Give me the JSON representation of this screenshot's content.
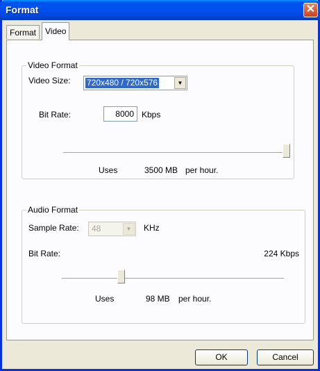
{
  "window": {
    "title": "Format",
    "close_label": "✕"
  },
  "tabs": [
    {
      "label": "Format"
    },
    {
      "label": "Video"
    }
  ],
  "video_format": {
    "legend": "Video Format",
    "size_label": "Video Size:",
    "size_value": "720x480 / 720x576",
    "bitrate_label": "Bit Rate:",
    "bitrate_value": "8000",
    "bitrate_unit": "Kbps",
    "slider_level": 1.0,
    "uses_label": "Uses",
    "uses_value": "3500 MB",
    "uses_suffix": "per hour."
  },
  "audio_format": {
    "legend": "Audio Format",
    "sample_rate_label": "Sample Rate:",
    "sample_rate_value": "48",
    "sample_rate_unit": "KHz",
    "bitrate_label": "Bit Rate:",
    "bitrate_value": "224 Kbps",
    "slider_level": 0.27,
    "uses_label": "Uses",
    "uses_value": "98 MB",
    "uses_suffix": "per hour."
  },
  "buttons": {
    "ok": "OK",
    "cancel": "Cancel"
  }
}
